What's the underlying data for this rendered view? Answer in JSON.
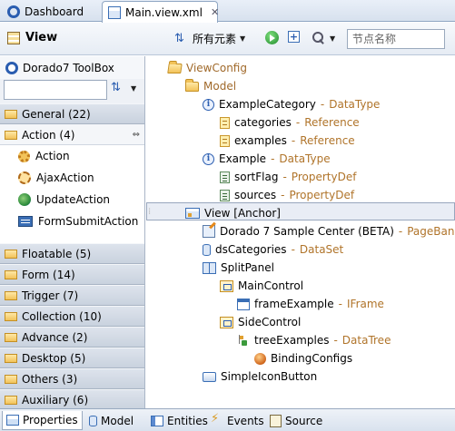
{
  "editor_tabs": [
    {
      "label": "Dashboard",
      "icon": "dashboard-icon"
    },
    {
      "label": "Main.view.xml",
      "icon": "xml-file-icon",
      "close": "✕"
    }
  ],
  "view_toolbar": {
    "title": "View",
    "language_label": "所有元素",
    "search_placeholder": "节点名称"
  },
  "toolbox": {
    "title": "Dorado7 ToolBox",
    "categories_top": [
      {
        "label": "General (22)"
      },
      {
        "label": "Action (4)"
      }
    ],
    "actions": [
      {
        "label": "Action",
        "icon": "gear-icon"
      },
      {
        "label": "AjaxAction",
        "icon": "ajax-icon"
      },
      {
        "label": "UpdateAction",
        "icon": "globe-icon"
      },
      {
        "label": "FormSubmitAction",
        "icon": "form-icon"
      }
    ],
    "categories_bottom": [
      {
        "label": "Floatable (5)"
      },
      {
        "label": "Form (14)"
      },
      {
        "label": "Trigger (7)"
      },
      {
        "label": "Collection (10)"
      },
      {
        "label": "Advance (2)"
      },
      {
        "label": "Desktop (5)"
      },
      {
        "label": "Others (3)"
      },
      {
        "label": "Auxiliary (6)"
      }
    ]
  },
  "tree": [
    {
      "name": "ViewConfig",
      "kind": "",
      "icon": "folder-open-icon",
      "indent": 0,
      "brown_name": true
    },
    {
      "name": "Model",
      "kind": "",
      "icon": "folder-icon",
      "indent": 1,
      "brown_name": true
    },
    {
      "name": "ExampleCategory",
      "kind": "DataType",
      "icon": "datatype-icon",
      "indent": 2
    },
    {
      "name": "categories",
      "kind": "Reference",
      "icon": "reference-icon",
      "indent": 3
    },
    {
      "name": "examples",
      "kind": "Reference",
      "icon": "reference-icon",
      "indent": 3
    },
    {
      "name": "Example",
      "kind": "DataType",
      "icon": "datatype-icon",
      "indent": 2
    },
    {
      "name": "sortFlag",
      "kind": "PropertyDef",
      "icon": "propertydef-icon",
      "indent": 3
    },
    {
      "name": "sources",
      "kind": "PropertyDef",
      "icon": "propertydef-icon",
      "indent": 3
    },
    {
      "name": "View [Anchor]",
      "kind": "",
      "icon": "view-icon",
      "indent": 1,
      "selected": true
    },
    {
      "name": "Dorado 7 Sample Center (BETA)",
      "kind": "PageBanner",
      "icon": "pagebanner-icon",
      "indent": 2
    },
    {
      "name": "dsCategories",
      "kind": "DataSet",
      "icon": "dataset-icon",
      "indent": 2
    },
    {
      "name": "SplitPanel",
      "kind": "",
      "icon": "splitpanel-icon",
      "indent": 2
    },
    {
      "name": "MainControl",
      "kind": "",
      "icon": "maincontrol-icon",
      "indent": 3
    },
    {
      "name": "frameExample",
      "kind": "IFrame",
      "icon": "iframe-icon",
      "indent": 4
    },
    {
      "name": "SideControl",
      "kind": "",
      "icon": "sidecontrol-icon",
      "indent": 3
    },
    {
      "name": "treeExamples",
      "kind": "DataTree",
      "icon": "datatree-icon",
      "indent": 4
    },
    {
      "name": "BindingConfigs",
      "kind": "",
      "icon": "bindingconfigs-icon",
      "indent": 5
    },
    {
      "name": "SimpleIconButton",
      "kind": "",
      "icon": "simpleiconbutton-icon",
      "indent": 2
    }
  ],
  "bottom_tabs": [
    {
      "label": "Properties",
      "icon": "properties-icon"
    },
    {
      "label": "Model",
      "icon": "model-icon"
    },
    {
      "label": "Entities",
      "icon": "entities-icon"
    },
    {
      "label": "Events",
      "icon": "events-icon"
    },
    {
      "label": "Source",
      "icon": "source-icon"
    }
  ]
}
